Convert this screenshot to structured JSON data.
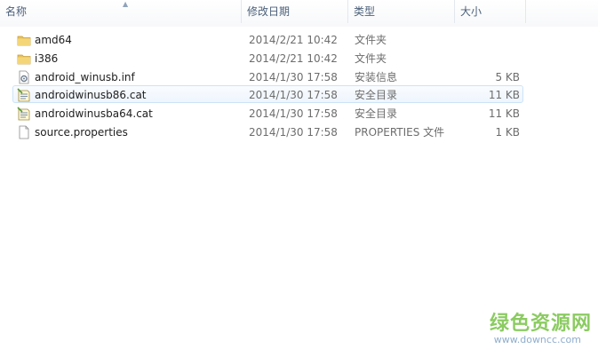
{
  "columns": {
    "name": "名称",
    "date": "修改日期",
    "type": "类型",
    "size": "大小"
  },
  "files": [
    {
      "name": "amd64",
      "date": "2014/2/21 10:42",
      "type": "文件夹",
      "size": "",
      "icon": "folder-icon"
    },
    {
      "name": "i386",
      "date": "2014/2/21 10:42",
      "type": "文件夹",
      "size": "",
      "icon": "folder-icon"
    },
    {
      "name": "android_winusb.inf",
      "date": "2014/1/30 17:58",
      "type": "安装信息",
      "size": "5 KB",
      "icon": "setup-info-icon"
    },
    {
      "name": "androidwinusb86.cat",
      "date": "2014/1/30 17:58",
      "type": "安全目录",
      "size": "11 KB",
      "icon": "security-catalog-icon"
    },
    {
      "name": "androidwinusba64.cat",
      "date": "2014/1/30 17:58",
      "type": "安全目录",
      "size": "11 KB",
      "icon": "security-catalog-icon"
    },
    {
      "name": "source.properties",
      "date": "2014/1/30 17:58",
      "type": "PROPERTIES 文件",
      "size": "1 KB",
      "icon": "file-icon"
    }
  ],
  "watermark": {
    "title": "绿色资源网",
    "url": "www.downcc.com"
  },
  "colors": {
    "header_text": "#4c607a",
    "selection_border": "#cde3f7",
    "folder": "#e8c15a",
    "watermark_green": "#6fbf3a"
  }
}
